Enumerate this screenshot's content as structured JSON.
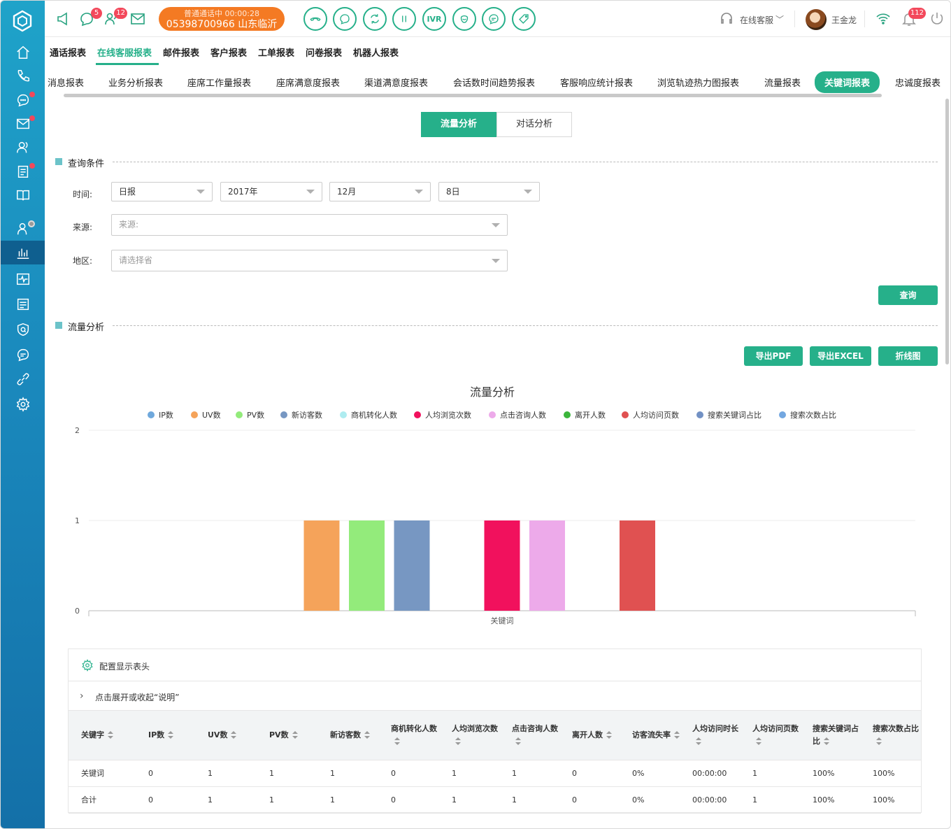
{
  "topbar": {
    "chat_badge": "5",
    "users_badge": "12",
    "call_status": "普通通话中  00:00:28",
    "call_number": "05398700966 山东临沂",
    "ivr_label": "IVR",
    "service_mode": "在线客服",
    "user_name": "王金龙",
    "notify_badge": "112"
  },
  "report_tabs": [
    "通话报表",
    "在线客服报表",
    "邮件报表",
    "客户报表",
    "工单报表",
    "问卷报表",
    "机器人报表"
  ],
  "sub_tabs": [
    "消息报表",
    "业务分析报表",
    "座席工作量报表",
    "座席满意度报表",
    "渠道满意度报表",
    "会话数时间趋势报表",
    "客服响应统计报表",
    "浏览轨迹热力图报表",
    "流量报表",
    "关键词报表",
    "忠诚度报表"
  ],
  "segment": {
    "on": "流量分析",
    "off": "对话分析"
  },
  "query": {
    "section_title": "查询条件",
    "time_label": "时间:",
    "time_type": "日报",
    "year": "2017年",
    "month": "12月",
    "day": "8日",
    "source_label": "来源:",
    "source_placeholder": "来源:",
    "region_label": "地区:",
    "region_placeholder": "请选择省",
    "query_button": "查询"
  },
  "analysis": {
    "section_title": "流量分析",
    "export_pdf": "导出PDF",
    "export_excel": "导出EXCEL",
    "line_chart": "折线图"
  },
  "chart_data": {
    "type": "bar",
    "title": "流量分析",
    "categories": [
      "关键词"
    ],
    "ylim": [
      0,
      2
    ],
    "yticks": [
      "0",
      "1",
      "2"
    ],
    "legend_position": "top",
    "series": [
      {
        "name": "IP数",
        "color": "#6fa8dc",
        "values": [
          0
        ]
      },
      {
        "name": "UV数",
        "color": "#f5a35a",
        "values": [
          1
        ]
      },
      {
        "name": "PV数",
        "color": "#93eb7b",
        "values": [
          1
        ]
      },
      {
        "name": "新访客数",
        "color": "#7797c2",
        "values": [
          1
        ]
      },
      {
        "name": "商机转化人数",
        "color": "#aeecf0",
        "values": [
          0
        ]
      },
      {
        "name": "人均浏览次数",
        "color": "#f1115d",
        "values": [
          1
        ]
      },
      {
        "name": "点击咨询人数",
        "color": "#edaaea",
        "values": [
          1
        ]
      },
      {
        "name": "离开人数",
        "color": "#3bb53b",
        "values": [
          0
        ]
      },
      {
        "name": "人均访问页数",
        "color": "#e05151",
        "values": [
          1
        ]
      },
      {
        "name": "搜索关键词占比",
        "color": "#7291c4",
        "values": [
          0
        ]
      },
      {
        "name": "搜索次数占比",
        "color": "#73a7e0",
        "values": [
          0
        ]
      }
    ]
  },
  "table": {
    "config_label": "配置显示表头",
    "expand_label": "点击展开或收起“说明”",
    "headers": [
      "关键字",
      "IP数",
      "UV数",
      "PV数",
      "新访客数",
      "商机转化人数",
      "人均浏览次数",
      "点击咨询人数",
      "离开人数",
      "访客流失率",
      "人均访问时长",
      "人均访问页数",
      "搜索关键词占比",
      "搜索次数占比"
    ],
    "rows": [
      [
        "关键词",
        "0",
        "1",
        "1",
        "1",
        "0",
        "1",
        "1",
        "0",
        "0%",
        "00:00:00",
        "1",
        "100%",
        "100%"
      ],
      [
        "合计",
        "0",
        "1",
        "1",
        "1",
        "0",
        "1",
        "1",
        "0",
        "0%",
        "00:00:00",
        "1",
        "100%",
        "100%"
      ]
    ]
  }
}
